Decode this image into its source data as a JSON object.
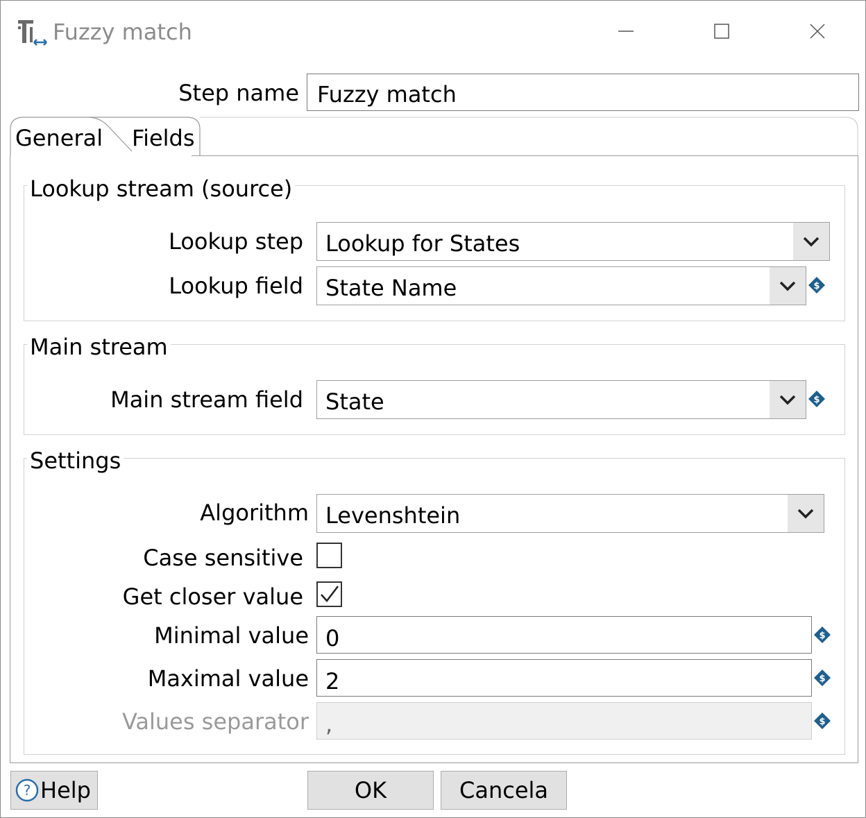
{
  "window": {
    "title": "Fuzzy match",
    "icon": "fuzzy-match-step-icon",
    "controls": [
      "minimize-icon",
      "maximize-icon",
      "close-icon"
    ]
  },
  "step_name": {
    "label": "Step name",
    "value": "Fuzzy match"
  },
  "tabs": [
    {
      "label": "General",
      "active": true
    },
    {
      "label": "Fields",
      "active": false
    }
  ],
  "lookup_group": {
    "title": "Lookup stream (source)",
    "lookup_step": {
      "label": "Lookup step",
      "value": "Lookup for States"
    },
    "lookup_field": {
      "label": "Lookup field",
      "value": "State Name"
    }
  },
  "main_group": {
    "title": "Main stream",
    "main_stream_field": {
      "label": "Main stream field",
      "value": "State"
    }
  },
  "settings_group": {
    "title": "Settings",
    "algorithm": {
      "label": "Algorithm",
      "value": "Levenshtein"
    },
    "case_sensitive": {
      "label": "Case sensitive",
      "checked": false
    },
    "get_closer_value": {
      "label": "Get closer value",
      "checked": true
    },
    "minimal_value": {
      "label": "Minimal value",
      "value": "0"
    },
    "maximal_value": {
      "label": "Maximal value",
      "value": "2"
    },
    "values_separator": {
      "label": "Values separator",
      "value": ",",
      "disabled": true
    }
  },
  "buttons": {
    "help": "Help",
    "ok": "OK",
    "cancel": "Cancela"
  },
  "colors": {
    "variable_icon": "#1f5f8b",
    "disabled_text": "#9a9a9a",
    "button_bg": "#e1e1e1"
  }
}
